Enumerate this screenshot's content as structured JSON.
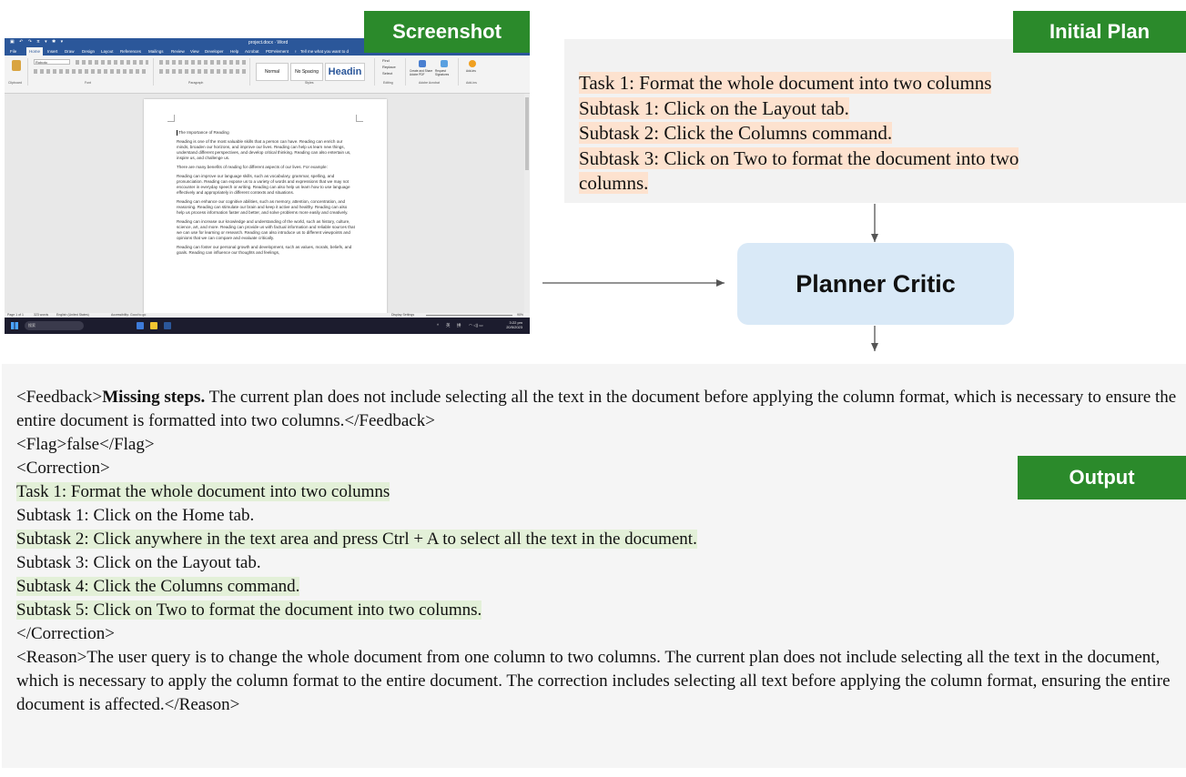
{
  "labels": {
    "screenshot": "Screenshot",
    "initial_plan": "Initial Plan",
    "output": "Output",
    "planner_critic": "Planner Critic"
  },
  "colors": {
    "tag_green": "#2b8a2b",
    "plan_highlight": "#fde2cf",
    "output_highlight": "#e3f0d8",
    "critic_box": "#d9e9f7",
    "word_blue": "#2b579a"
  },
  "screenshot": {
    "document_name": "project.docx · Word",
    "tabs": [
      "File",
      "Home",
      "Insert",
      "Draw",
      "Design",
      "Layout",
      "References",
      "Mailings",
      "Review",
      "View",
      "Developer",
      "Help",
      "Acrobat",
      "PDFelement"
    ],
    "tell_me": "Tell me what you want to d",
    "font_name": "Roboto",
    "styles": [
      "Normal",
      "No Spacing",
      "Headin"
    ],
    "ribbon_groups": [
      "Clipboard",
      "Font",
      "Paragraph",
      "Styles",
      "Editing",
      "Adobe Acrobat",
      "Add-ins"
    ],
    "editing_items": [
      "Find",
      "Replace",
      "Select"
    ],
    "acrobat_items": [
      "Create and Share Adobe PDF",
      "Request Signatures"
    ],
    "addins_label": "Add-ins",
    "doc_title": "The Importance of Reading",
    "paragraphs": [
      "Reading is one of the most valuable skills that a person can have. Reading can enrich our minds, broaden our horizons, and improve our lives. Reading can help us learn new things, understand different perspectives, and develop critical thinking. Reading can also entertain us, inspire us, and challenge us.",
      "There are many benefits of reading for different aspects of our lives. For example:",
      "Reading can improve our language skills, such as vocabulary, grammar, spelling, and pronunciation. Reading can expose us to a variety of words and expressions that we may not encounter in everyday speech or writing. Reading can also help us learn how to use language effectively and appropriately in different contexts and situations.",
      "Reading can enhance our cognitive abilities, such as memory, attention, concentration, and reasoning. Reading can stimulate our brain and keep it active and healthy. Reading can also help us process information faster and better, and solve problems more easily and creatively.",
      "Reading can increase our knowledge and understanding of the world, such as history, culture, science, art, and more. Reading can provide us with factual information and reliable sources that we can use for learning or research. Reading can also introduce us to different viewpoints and opinions that we can compare and evaluate critically.",
      "Reading can foster our personal growth and development, such as values, morals, beliefs, and goals. Reading can influence our thoughts and feelings,"
    ],
    "status_left": [
      "Page 1 of 1",
      "323 words",
      "English (United States)",
      "Accessibility: Good to go"
    ],
    "status_right": [
      "Display Settings",
      "90%"
    ],
    "taskbar_search": "搜索",
    "taskbar_sys": [
      "英",
      "拼"
    ],
    "clock_time": "3:22 pm",
    "clock_date": "20/5/2023"
  },
  "initial_plan": {
    "lines": [
      "Task 1: Format the whole document into two columns",
      "Subtask 1: Click on the Layout tab.",
      "Subtask 2: Click the Columns command.",
      "Subtask 3: Click on Two to format the document into two",
      "columns."
    ]
  },
  "output": {
    "feedback_open": "<Feedback>",
    "feedback_bold": "Missing steps.",
    "feedback_text": " The current plan does not include selecting all the text in the document before applying the column format, which is necessary to ensure the entire document is formatted into two columns.</Feedback>",
    "flag": "<Flag>false</Flag>",
    "correction_open": "<Correction>",
    "correction_lines": [
      "Task 1: Format the whole document into two columns",
      "Subtask 1: Click on the Home tab.",
      "Subtask 2: Click anywhere in the text area and press Ctrl + A to select all the text in the document.",
      "Subtask 3: Click on the Layout tab.",
      "Subtask 4: Click the Columns command.",
      "Subtask 5: Click on Two to format the document into two columns."
    ],
    "correction_close": "</Correction>",
    "reason": "<Reason>The user query is to change the whole document from one column to two columns. The current plan does not include selecting all the text in the document, which is necessary to apply the column format to the entire document. The correction includes selecting all text before applying the column format, ensuring the entire document is affected.</Reason>"
  }
}
